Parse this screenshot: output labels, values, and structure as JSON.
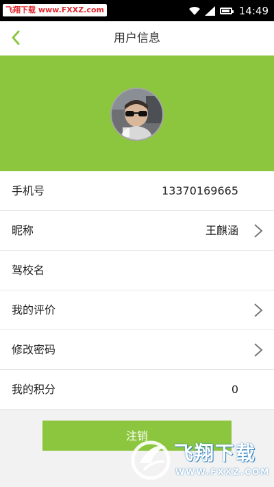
{
  "status_bar": {
    "watermark": "飞翔下载 www.FXXZ.com",
    "time": "14:49"
  },
  "nav": {
    "title": "用户信息"
  },
  "rows": [
    {
      "label": "手机号",
      "value": "13370169665"
    },
    {
      "label": "昵称",
      "value": "王麒涵"
    },
    {
      "label": "驾校名",
      "value": ""
    },
    {
      "label": "我的评价",
      "value": ""
    },
    {
      "label": "修改密码",
      "value": ""
    },
    {
      "label": "我的积分",
      "value": "0"
    }
  ],
  "logout_label": "注销",
  "watermark_logo": {
    "brand": "飞翔下载",
    "site": "WWW.FXXZ.COM"
  },
  "colors": {
    "accent": "#8cc63f",
    "back_arrow": "#8cc63f"
  }
}
